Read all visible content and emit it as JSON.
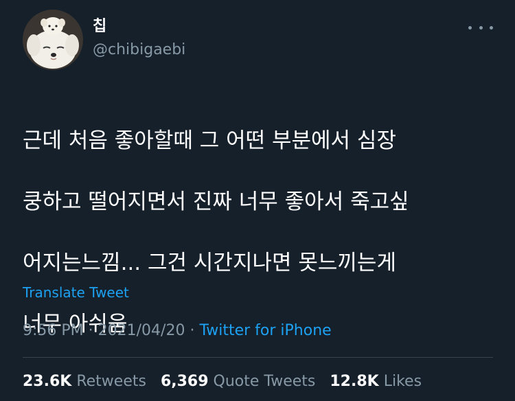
{
  "author": {
    "display_name": "칩",
    "handle": "@chibigaebi",
    "avatar_icon": "puppy-avatar"
  },
  "menu": {
    "icon": "more-horizontal-icon"
  },
  "tweet": {
    "lines": [
      "근데 처음 좋아할때 그 어떤 부분에서 심장",
      "쿵하고 떨어지면서 진짜 너무 좋아서 죽고싶",
      "어지는느낌... 그건 시간지나면 못느끼는게",
      "너무 아쉬움"
    ]
  },
  "translate_label": "Translate Tweet",
  "meta": {
    "time": "9:56 PM",
    "separator1": " · ",
    "date": "2021/04/20",
    "separator2": " · ",
    "source": "Twitter for iPhone"
  },
  "stats": {
    "retweets": {
      "count": "23.6K",
      "label": "Retweets"
    },
    "quotes": {
      "count": "6,369",
      "label": "Quote Tweets"
    },
    "likes": {
      "count": "12.8K",
      "label": "Likes"
    }
  },
  "colors": {
    "background": "#15202b",
    "secondary_text": "#8899a6",
    "accent": "#1da1f2",
    "divider": "#38444d"
  }
}
